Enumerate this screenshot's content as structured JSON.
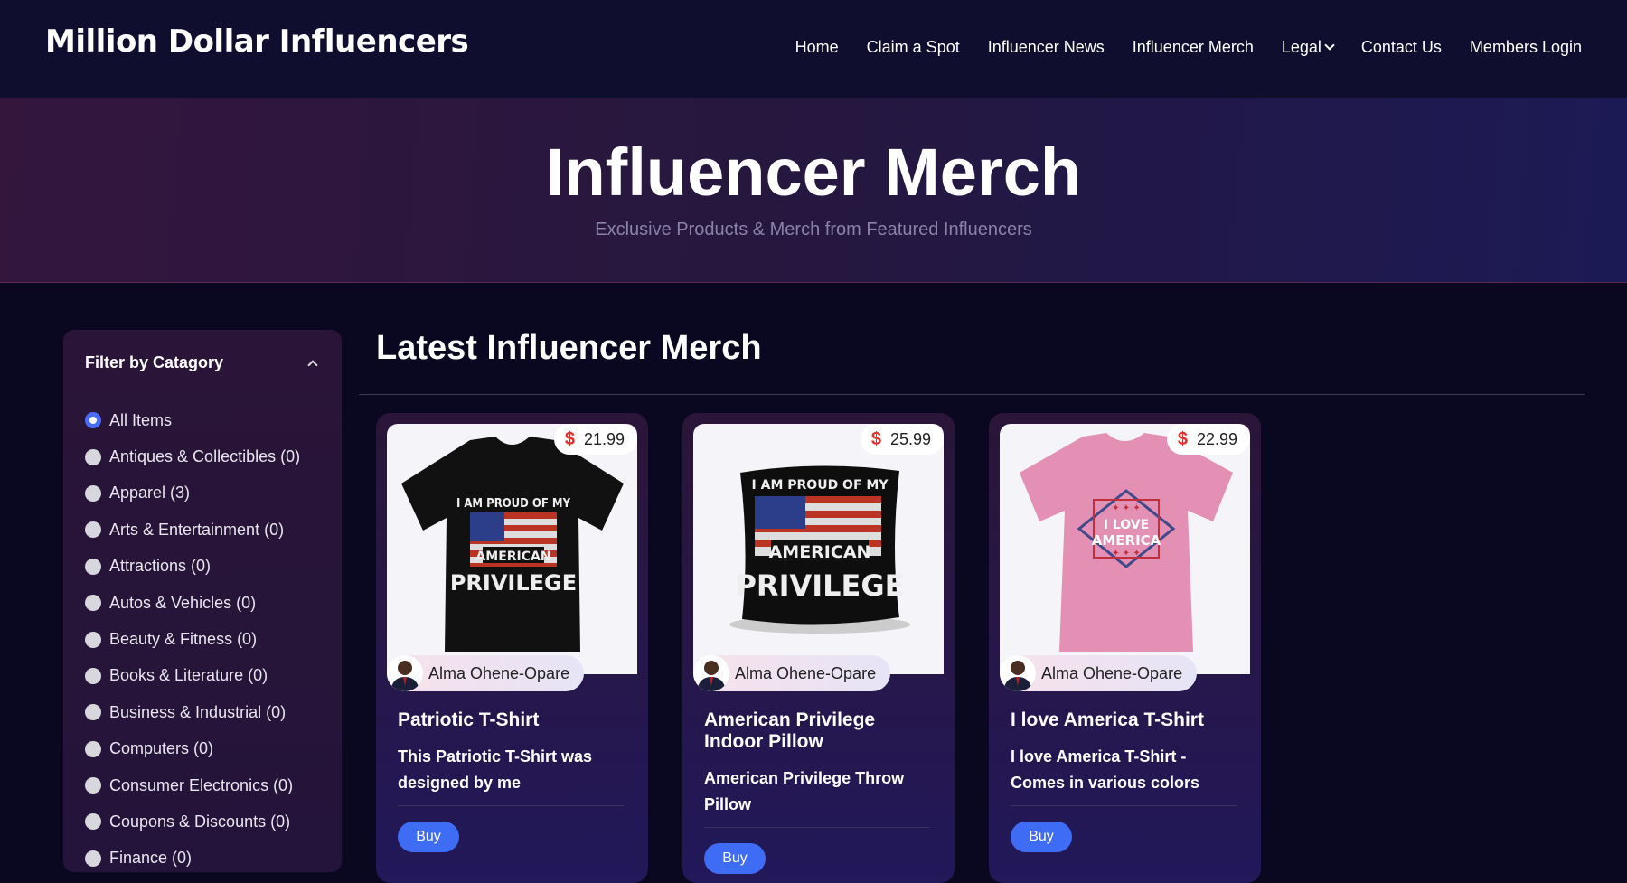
{
  "nav": {
    "logo": "Million Dollar Influencers",
    "links": [
      {
        "label": "Home"
      },
      {
        "label": "Claim a Spot"
      },
      {
        "label": "Influencer News"
      },
      {
        "label": "Influencer Merch"
      },
      {
        "label": "Legal"
      },
      {
        "label": "Contact Us"
      },
      {
        "label": "Members Login"
      }
    ]
  },
  "hero": {
    "title": "Influencer Merch",
    "subtitle": "Exclusive Products & Merch from Featured Influencers"
  },
  "filter": {
    "title": "Filter by Catagory",
    "selected": "All Items",
    "categories": [
      "All Items",
      "Antiques & Collectibles (0)",
      "Apparel (3)",
      "Arts & Entertainment (0)",
      "Attractions (0)",
      "Autos & Vehicles (0)",
      "Beauty & Fitness (0)",
      "Books & Literature (0)",
      "Business & Industrial (0)",
      "Computers (0)",
      "Consumer Electronics (0)",
      "Coupons & Discounts (0)",
      "Finance (0)"
    ]
  },
  "section": {
    "title": "Latest Influencer Merch"
  },
  "products": [
    {
      "price": "21.99",
      "currency": "$",
      "author": "Alma Ohene-Opare",
      "title": "Patriotic T-Shirt",
      "description": "This Patriotic T-Shirt was designed by me",
      "buy_label": "Buy",
      "image_text": [
        "I AM PROUD OF MY",
        "AMERICAN",
        "PRIVILEGE"
      ]
    },
    {
      "price": "25.99",
      "currency": "$",
      "author": "Alma Ohene-Opare",
      "title": "American Privilege Indoor Pillow",
      "description": "American Privilege Throw Pillow",
      "buy_label": "Buy",
      "image_text": [
        "I AM PROUD OF MY",
        "AMERICAN",
        "PRIVILEGE"
      ]
    },
    {
      "price": "22.99",
      "currency": "$",
      "author": "Alma Ohene-Opare",
      "title": "I love America T-Shirt",
      "description": "I love America T-Shirt - Comes in various colors",
      "buy_label": "Buy",
      "image_text": [
        "I LOVE",
        "AMERICA"
      ]
    }
  ],
  "colors": {
    "nav_bg": "#100e2e",
    "page_bg": "#0a0820",
    "accent": "#3f6cf5",
    "price_symbol": "#e0322e"
  }
}
